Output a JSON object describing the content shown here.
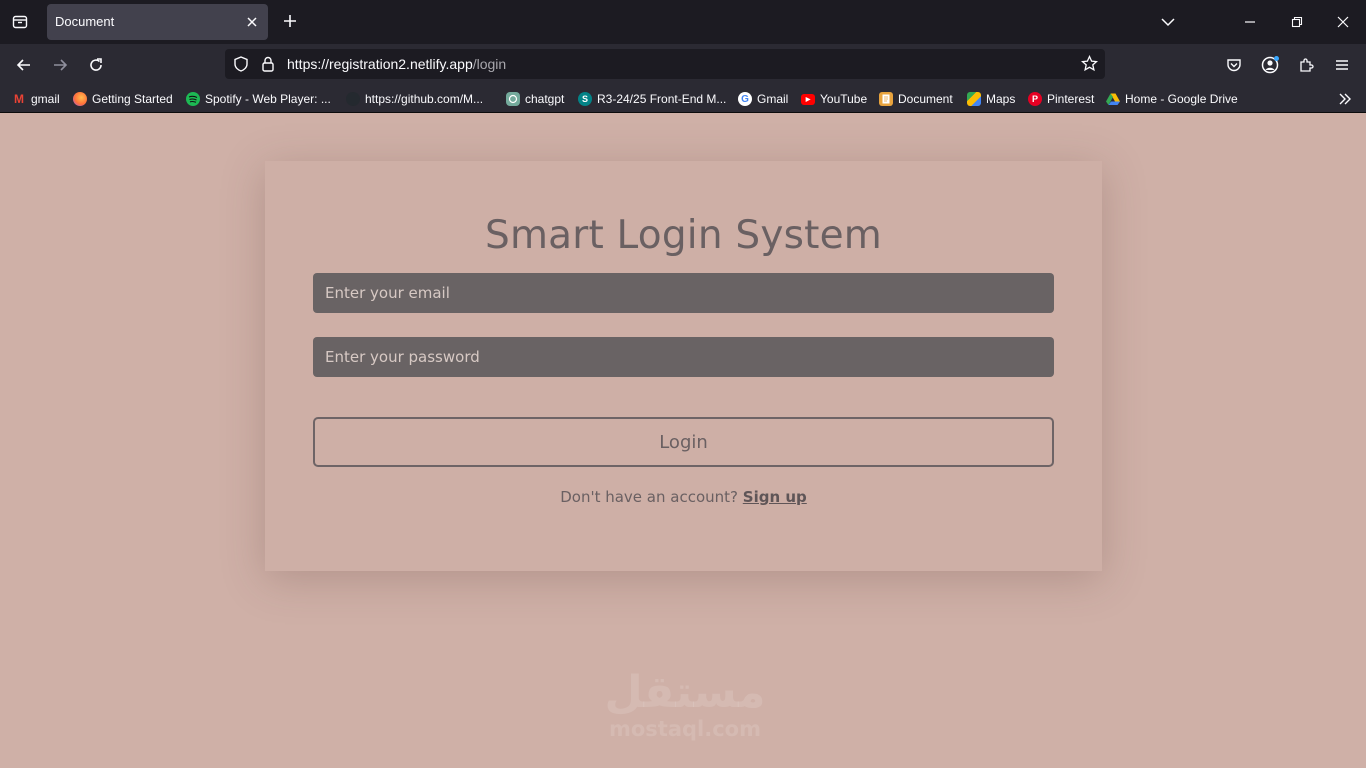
{
  "browser": {
    "tab_title": "Document",
    "url_host": "https://registration2.netlify.app",
    "url_path": "/login",
    "bookmarks": [
      {
        "label": "gmail",
        "icon": "gmail-icon",
        "color": "#ea4335",
        "glyph": "M"
      },
      {
        "label": "Getting Started",
        "icon": "firefox-icon",
        "color": "#ff7139",
        "glyph": ""
      },
      {
        "label": "Spotify - Web Player: ...",
        "icon": "spotify-icon",
        "color": "#1db954",
        "glyph": ""
      },
      {
        "label": "https://github.com/M...",
        "icon": "github-icon",
        "color": "#24292f",
        "glyph": ""
      },
      {
        "label": "chatgpt",
        "icon": "chatgpt-icon",
        "color": "#74aa9c",
        "glyph": ""
      },
      {
        "label": "R3-24/25 Front-End M...",
        "icon": "sharepoint-icon",
        "color": "#038387",
        "glyph": "S"
      },
      {
        "label": "Gmail",
        "icon": "google-icon",
        "color": "#ffffff",
        "glyph": "G"
      },
      {
        "label": "YouTube",
        "icon": "youtube-icon",
        "color": "#ff0000",
        "glyph": "▶"
      },
      {
        "label": "Document",
        "icon": "document-icon",
        "color": "#e8a33d",
        "glyph": ""
      },
      {
        "label": "Maps",
        "icon": "maps-icon",
        "color": "#34a853",
        "glyph": ""
      },
      {
        "label": "Pinterest",
        "icon": "pinterest-icon",
        "color": "#e60023",
        "glyph": "P"
      },
      {
        "label": "Home - Google Drive",
        "icon": "google-drive-icon",
        "color": "#4285f4",
        "glyph": ""
      }
    ]
  },
  "login": {
    "title": "Smart Login System",
    "email_placeholder": "Enter your email",
    "password_placeholder": "Enter your password",
    "login_label": "Login",
    "signup_prompt": "Don't have an account?",
    "signup_link": "Sign up"
  },
  "watermark": {
    "arabic": "مستقل",
    "latin": "mostaql.com"
  },
  "colors": {
    "page_bg": "#cfb0a7",
    "input_bg": "#696364",
    "text": "#6a6062"
  }
}
